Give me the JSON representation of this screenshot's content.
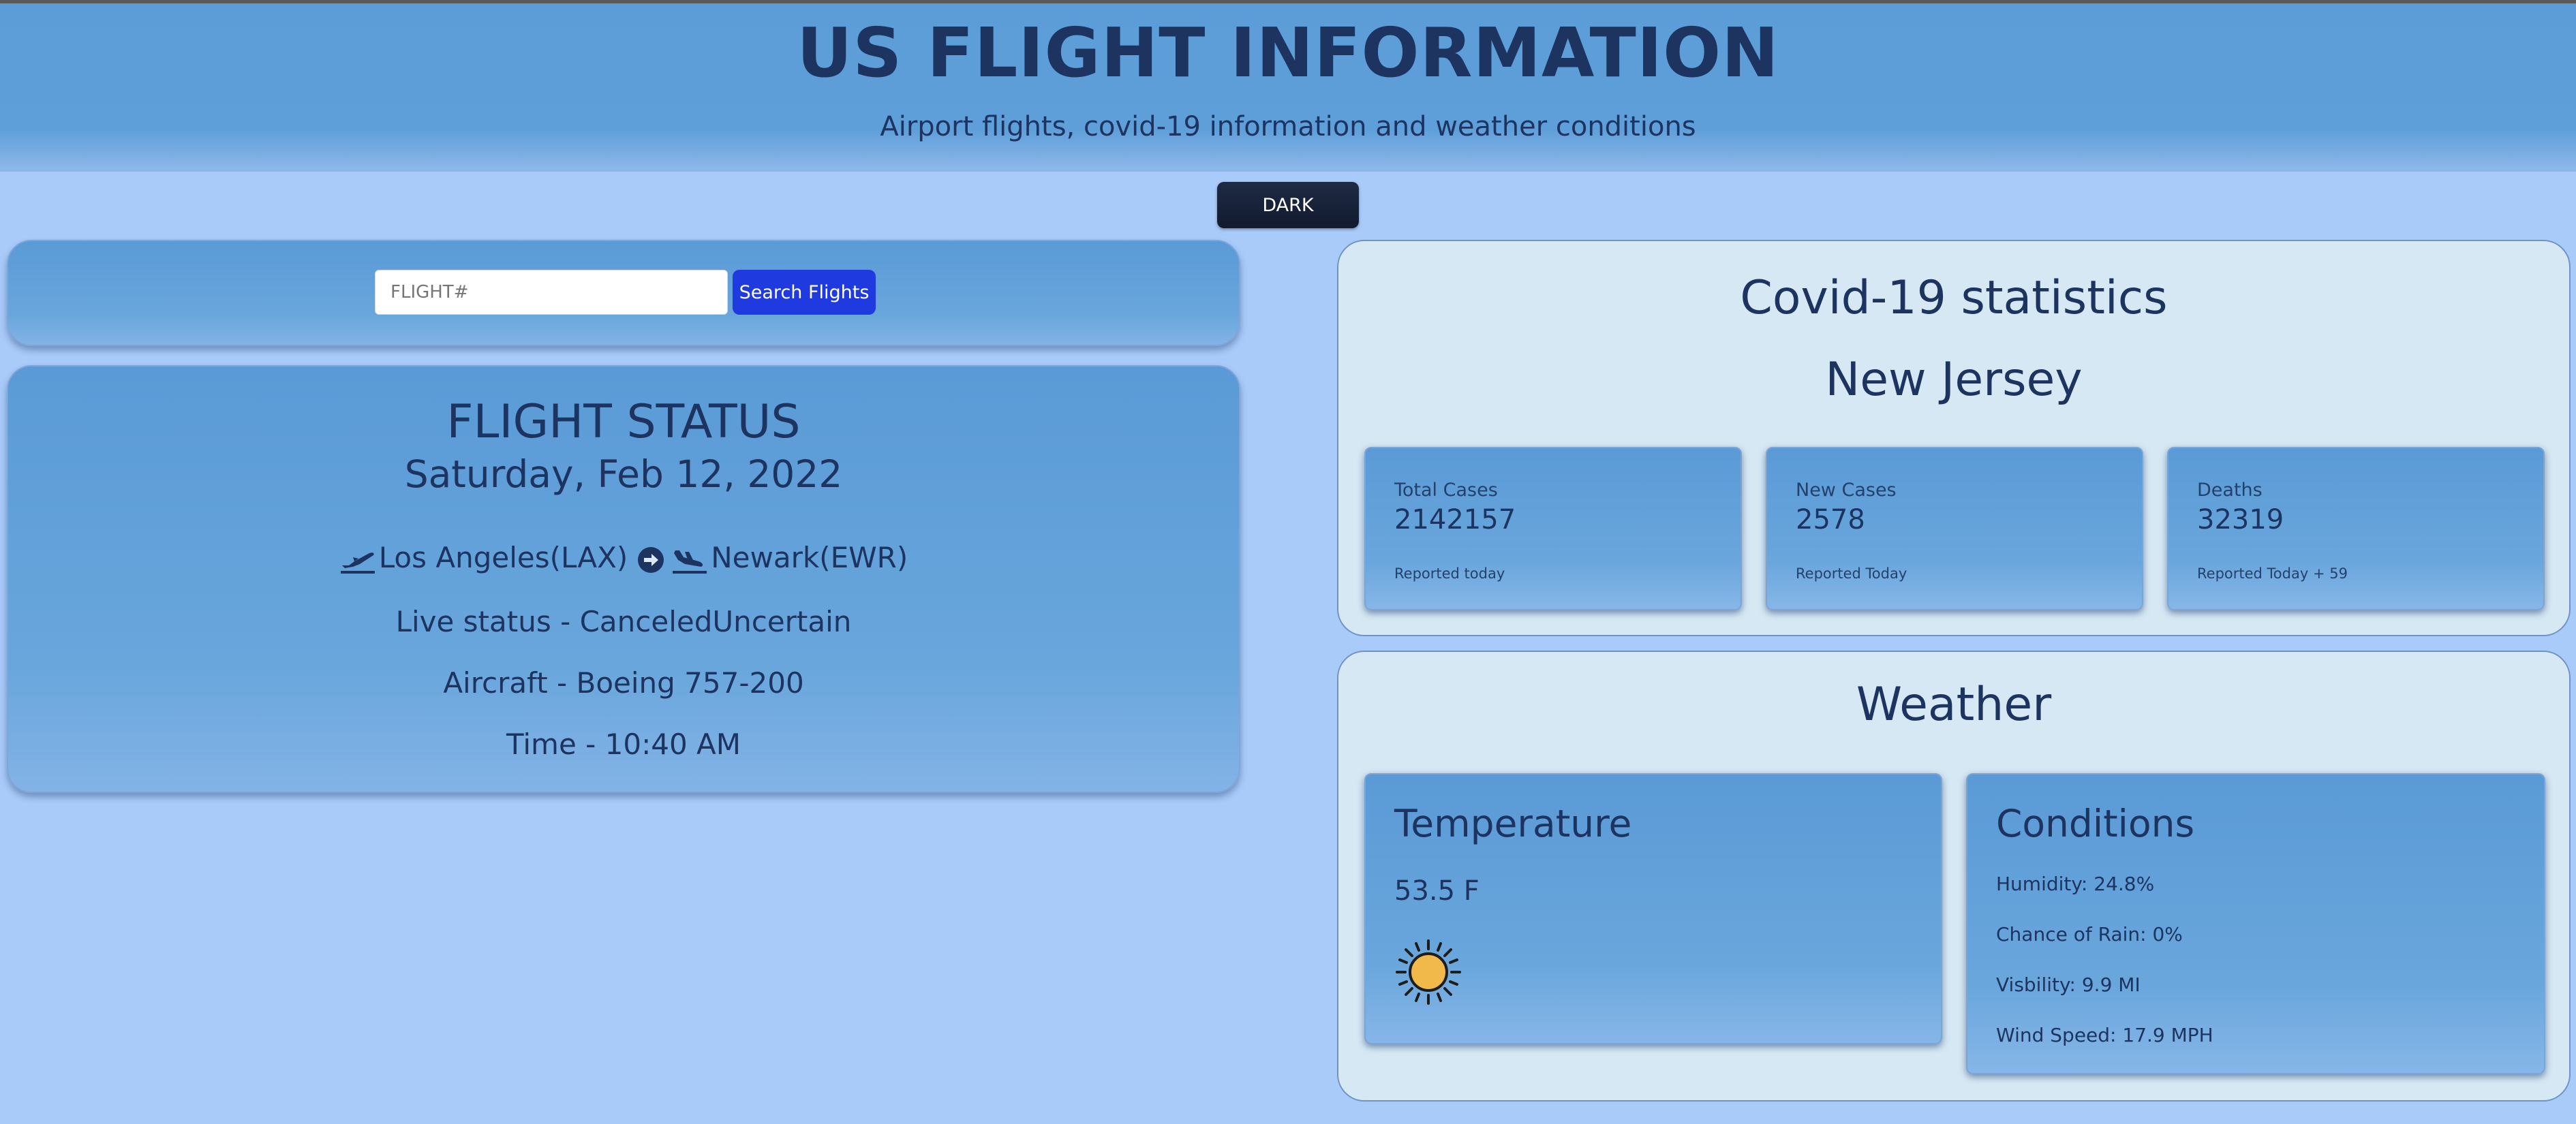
{
  "header": {
    "title": "US FLIGHT INFORMATION",
    "subtitle": "Airport flights, covid-19 information and weather conditions"
  },
  "theme_toggle": {
    "label": "DARK"
  },
  "search": {
    "placeholder": "FLIGHT#",
    "button_label": "Search Flights"
  },
  "flight_status": {
    "title": "FLIGHT STATUS",
    "date": "Saturday, Feb 12, 2022",
    "origin": "Los Angeles(LAX)",
    "destination": "Newark(EWR)",
    "live_status": "Live status - CanceledUncertain",
    "aircraft": "Aircraft - Boeing 757-200",
    "time": "Time - 10:40 AM"
  },
  "covid": {
    "title": "Covid-19 statistics",
    "state": "New Jersey",
    "cards": [
      {
        "label": "Total Cases",
        "value": "2142157",
        "note": "Reported today"
      },
      {
        "label": "New Cases",
        "value": "2578",
        "note": "Reported Today"
      },
      {
        "label": "Deaths",
        "value": "32319",
        "note": "Reported Today + 59"
      }
    ]
  },
  "weather": {
    "title": "Weather",
    "temperature": {
      "title": "Temperature",
      "value": "53.5 F",
      "icon": "sun-icon"
    },
    "conditions": {
      "title": "Conditions",
      "humidity": "Humidity: 24.8%",
      "rain": "Chance of Rain: 0%",
      "visibility": "Visbility: 9.9 MI",
      "wind": "Wind Speed: 17.9 MPH"
    }
  },
  "colors": {
    "header_bg": "#5c9cd7",
    "page_bg": "#a9cbfa",
    "text": "#1d3461",
    "search_button": "#1f3be0",
    "dark_button": "#1a2540",
    "light_card": "#d6e8f4",
    "sun": "#f0b94a"
  }
}
